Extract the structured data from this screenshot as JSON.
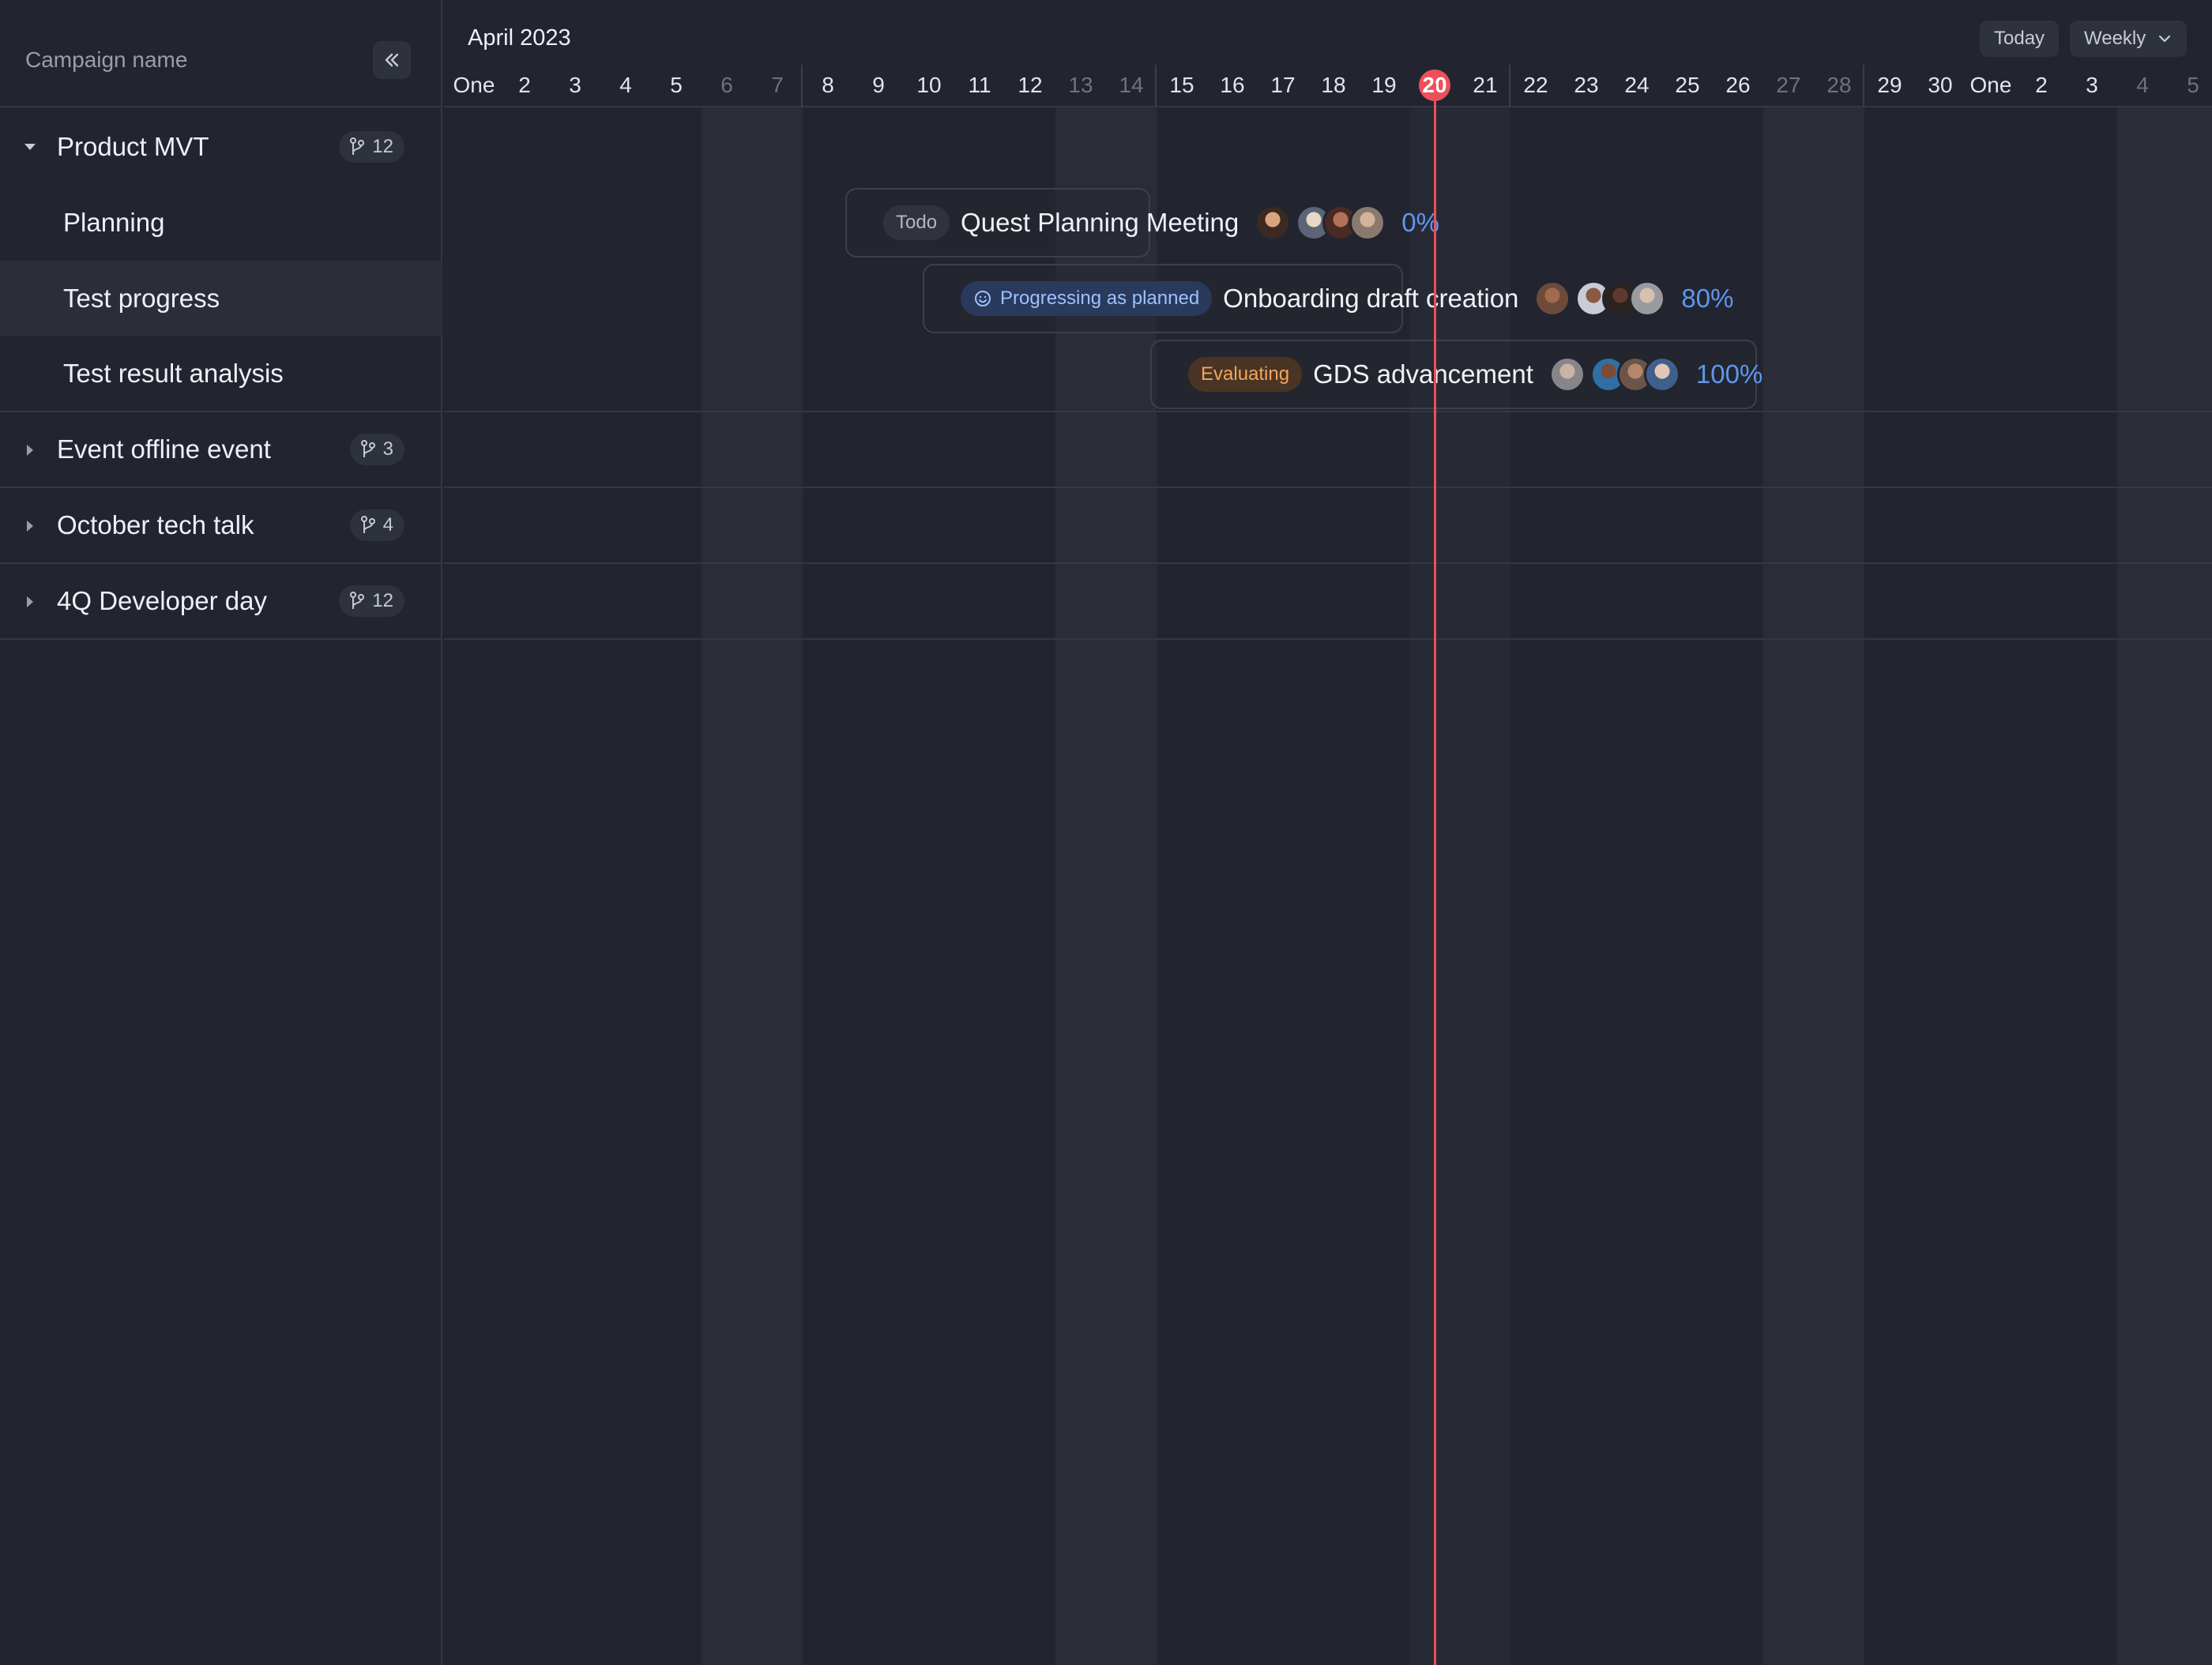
{
  "sidebar": {
    "title": "Campaign name",
    "groups": [
      {
        "label": "Product MVT",
        "count": "12",
        "expanded": true,
        "children": [
          {
            "label": "Planning"
          },
          {
            "label": "Test progress"
          },
          {
            "label": "Test result analysis"
          }
        ]
      },
      {
        "label": "Event offline event",
        "count": "3",
        "expanded": false
      },
      {
        "label": "October tech talk",
        "count": "4",
        "expanded": false
      },
      {
        "label": "4Q Developer day",
        "count": "12",
        "expanded": false
      }
    ]
  },
  "timeline": {
    "month": "April 2023",
    "today_button": "Today",
    "view_select": "Weekly",
    "days": [
      "One",
      "2",
      "3",
      "4",
      "5",
      "6",
      "7",
      "8",
      "9",
      "10",
      "11",
      "12",
      "13",
      "14",
      "15",
      "16",
      "17",
      "18",
      "19",
      "20",
      "21",
      "22",
      "23",
      "24",
      "25",
      "26",
      "27",
      "28",
      "29",
      "30",
      "One",
      "2",
      "3",
      "4",
      "5"
    ],
    "today": "20"
  },
  "tasks": [
    {
      "status": "Todo",
      "name": "Quest Planning Meeting",
      "progress": "0%"
    },
    {
      "status": "Progressing as planned",
      "name": "Onboarding draft creation",
      "progress": "80%"
    },
    {
      "status": "Evaluating",
      "name": "GDS advancement",
      "progress": "100%"
    }
  ],
  "colors": {
    "accent": "#5f96ef",
    "today": "#ef4f5a",
    "todo": "#b3b7c2",
    "progressing": "#9fc1ff",
    "evaluating": "#f2a55e"
  }
}
